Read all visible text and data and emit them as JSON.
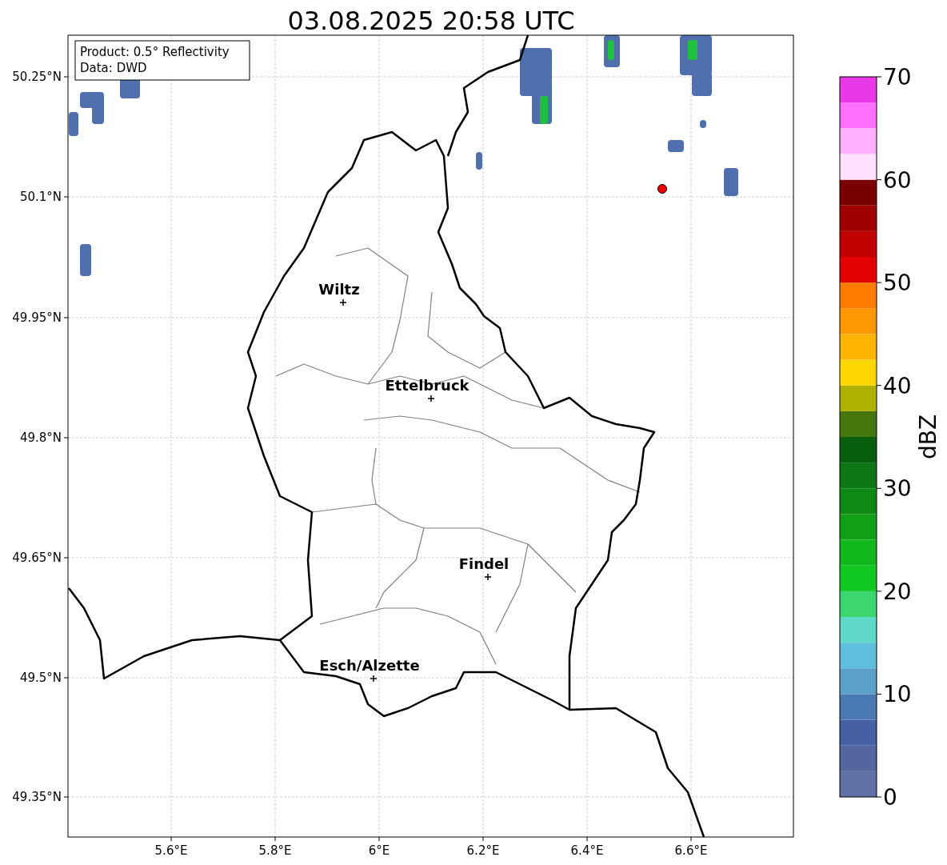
{
  "title": "03.08.2025 20:58 UTC",
  "info_box": [
    "Product: 0.5° Reflectivity",
    "Data: DWD"
  ],
  "map": {
    "cities": [
      "Wiltz",
      "Ettelbruck",
      "Findel",
      "Esch/Alzette"
    ],
    "y_ticks": [
      "50.25°N",
      "50.1°N",
      "49.95°N",
      "49.8°N",
      "49.65°N",
      "49.5°N",
      "49.35°N"
    ],
    "x_ticks": [
      "5.6°E",
      "5.8°E",
      "6°E",
      "6.2°E",
      "6.4°E",
      "6.6°E"
    ]
  },
  "colorbar": {
    "label": "dBZ",
    "ticks": [
      "70",
      "60",
      "50",
      "40",
      "30",
      "20",
      "10",
      "0"
    ],
    "segments": [
      {
        "color": "#6070a5"
      },
      {
        "color": "#5366a0"
      },
      {
        "color": "#4460a3"
      },
      {
        "color": "#4a78b0"
      },
      {
        "color": "#5aa0c8"
      },
      {
        "color": "#60bedd"
      },
      {
        "color": "#60d8c8"
      },
      {
        "color": "#3cd670"
      },
      {
        "color": "#10c820"
      },
      {
        "color": "#10b81c"
      },
      {
        "color": "#10a018"
      },
      {
        "color": "#0e8a14"
      },
      {
        "color": "#0c7514"
      },
      {
        "color": "#085e0e"
      },
      {
        "color": "#46760e"
      },
      {
        "color": "#b0b000"
      },
      {
        "color": "#ffd700"
      },
      {
        "color": "#ffb500"
      },
      {
        "color": "#ff9800"
      },
      {
        "color": "#ff7c00"
      },
      {
        "color": "#e20000"
      },
      {
        "color": "#c30000"
      },
      {
        "color": "#a00000"
      },
      {
        "color": "#7a0000"
      },
      {
        "color": "#ffe0ff"
      },
      {
        "color": "#ffb0ff"
      },
      {
        "color": "#ff70ff"
      },
      {
        "color": "#e838e8"
      }
    ]
  }
}
